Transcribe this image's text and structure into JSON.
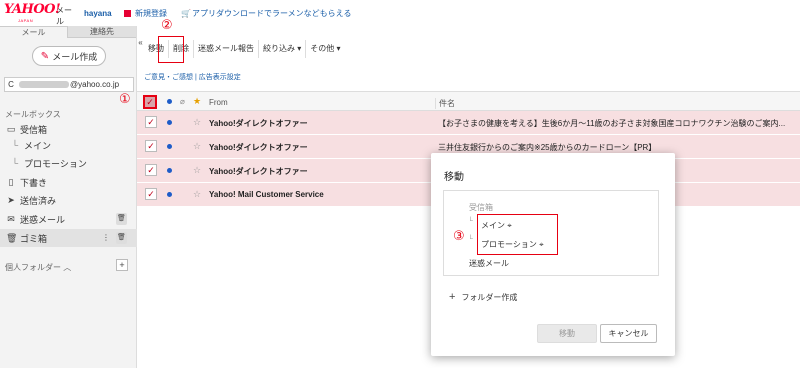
{
  "header": {
    "logo_brand": "YAHOO!",
    "logo_sub": "JAPAN",
    "logo_service": "メール",
    "username": "hayana",
    "nav": [
      {
        "label": "新規登録",
        "icon": "new-icon"
      },
      {
        "label": "アプリダウンロードでラーメンなどもらえる",
        "icon": "cart-icon"
      }
    ]
  },
  "sidebar": {
    "tabs": [
      "メール",
      "連絡先"
    ],
    "compose_label": "メール作成",
    "account_suffix": "@yahoo.co.jp",
    "mailbox_label": "メールボックス",
    "folders": [
      {
        "label": "受信箱",
        "icon": "inbox-icon"
      },
      {
        "label": "メイン",
        "icon": "tree-branch-icon"
      },
      {
        "label": "プロモーション",
        "icon": "tree-branch-icon"
      },
      {
        "label": "下書き",
        "icon": "draft-icon"
      },
      {
        "label": "送信済み",
        "icon": "send-icon"
      },
      {
        "label": "迷惑メール",
        "icon": "spam-icon"
      },
      {
        "label": "ゴミ箱",
        "icon": "trash-icon"
      }
    ],
    "personal_folders_label": "個人フォルダー"
  },
  "toolbar": {
    "items": [
      "移動",
      "削除",
      "迷惑メール報告",
      "絞り込み",
      "その他"
    ],
    "subbar": "ご意見・ご感想 | 広告表示設定"
  },
  "mail_list": {
    "columns": {
      "from": "From",
      "subject": "件名"
    },
    "rows": [
      {
        "from": "Yahoo!ダイレクトオファー",
        "subject": "【お子さまの健康を考える】生後6か月～11歳のお子さま対象国産コロナワクチン治験のご案内..."
      },
      {
        "from": "Yahoo!ダイレクトオファー",
        "subject": "三井住友銀行からのご案内※25歳からのカードローン【PR】"
      },
      {
        "from": "Yahoo!ダイレクトオファー",
        "subject": ""
      },
      {
        "from": "Yahoo! Mail Customer Service",
        "subject": ""
      }
    ]
  },
  "annotations": [
    "①",
    "②",
    "③"
  ],
  "modal": {
    "title": "移動",
    "folders": [
      {
        "label": "受信箱",
        "dimmed": true
      },
      {
        "label": "メイン",
        "dimmed": false
      },
      {
        "label": "プロモーション",
        "dimmed": false
      },
      {
        "label": "迷惑メール",
        "dimmed": false
      }
    ],
    "add_folder_label": "フォルダー作成",
    "move_button": "移動",
    "cancel_button": "キャンセル"
  },
  "colors": {
    "accent_red": "#e60012",
    "selected_row": "#f7dfe1",
    "link_blue": "#1a5ea8",
    "unread_dot": "#1e5cc8"
  }
}
